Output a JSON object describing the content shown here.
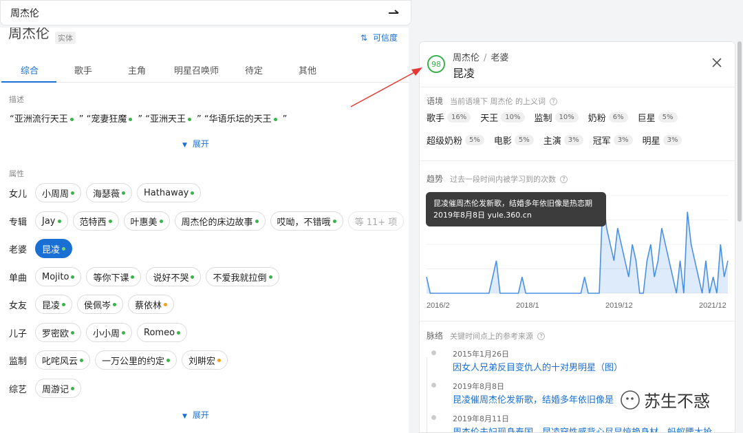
{
  "search": {
    "value": "周杰伦"
  },
  "entity": {
    "name": "周杰伦",
    "type": "实体",
    "confidence_label": "可信度"
  },
  "tabs": [
    "综合",
    "歌手",
    "主角",
    "明星召唤师",
    "待定",
    "其他"
  ],
  "description": {
    "label": "描述",
    "items": [
      "“亚洲流行天王",
      "” “宠妻狂魔",
      "” “亚洲天王",
      "” “华语乐坛的天王",
      "”"
    ],
    "expand": "展开"
  },
  "attributes": {
    "label": "属性",
    "rows": [
      {
        "key": "女儿",
        "values": [
          {
            "v": "小周周",
            "dot": "green"
          },
          {
            "v": "海瑟薇",
            "dot": "green"
          },
          {
            "v": "Hathaway",
            "dot": "green"
          }
        ]
      },
      {
        "key": "专辑",
        "values": [
          {
            "v": "Jay",
            "dot": "green"
          },
          {
            "v": "范特西",
            "dot": "green"
          },
          {
            "v": "叶惠美",
            "dot": "green"
          },
          {
            "v": "周杰伦的床边故事",
            "dot": "green"
          },
          {
            "v": "哎呦，不错哦",
            "dot": "green"
          }
        ],
        "more": "等 11+ 项"
      },
      {
        "key": "老婆",
        "values": [
          {
            "v": "昆凌",
            "dot": "green",
            "selected": true
          }
        ]
      },
      {
        "key": "单曲",
        "values": [
          {
            "v": "Mojito",
            "dot": "green"
          },
          {
            "v": "等你下课",
            "dot": "green"
          },
          {
            "v": "说好不哭",
            "dot": "green"
          },
          {
            "v": "不爱我就拉倒",
            "dot": "green"
          }
        ]
      },
      {
        "key": "女友",
        "values": [
          {
            "v": "昆凌",
            "dot": "green"
          },
          {
            "v": "侯佩岑",
            "dot": "green"
          },
          {
            "v": "蔡依林",
            "dot": "orange"
          }
        ]
      },
      {
        "key": "儿子",
        "values": [
          {
            "v": "罗密欧",
            "dot": "green"
          },
          {
            "v": "小小周",
            "dot": "green"
          },
          {
            "v": "Romeo",
            "dot": "green"
          }
        ]
      },
      {
        "key": "监制",
        "values": [
          {
            "v": "叱咤风云",
            "dot": "green"
          },
          {
            "v": "一万公里的约定",
            "dot": "green"
          },
          {
            "v": "刘畊宏",
            "dot": "orange"
          }
        ]
      },
      {
        "key": "综艺",
        "values": [
          {
            "v": "周游记",
            "dot": "green"
          }
        ]
      }
    ],
    "expand": "展开"
  },
  "detail": {
    "score": "98",
    "breadcrumb": [
      "周杰伦",
      "老婆"
    ],
    "target": "昆凌",
    "context": {
      "label": "语境",
      "sub": "当前语境下 周杰伦 的上义词",
      "rows": [
        [
          {
            "w": "歌手",
            "p": "16%"
          },
          {
            "w": "天王",
            "p": "10%"
          },
          {
            "w": "监制",
            "p": "10%"
          },
          {
            "w": "奶粉",
            "p": "6%"
          },
          {
            "w": "巨星",
            "p": "5%"
          }
        ],
        [
          {
            "w": "超级奶粉",
            "p": "5%"
          },
          {
            "w": "电影",
            "p": "5%"
          },
          {
            "w": "主演",
            "p": "3%"
          },
          {
            "w": "冠军",
            "p": "3%"
          },
          {
            "w": "明星",
            "p": "3%"
          }
        ]
      ]
    },
    "trend": {
      "label": "趋势",
      "sub": "过去一段时间内被学习到的次数",
      "tooltip_title": "昆凌催周杰伦发新歌，结婚多年依旧像是热恋期",
      "tooltip_meta": "2019年8月8日  yule.360.cn"
    },
    "timeline": {
      "label": "脉络",
      "sub": "关键时间点上的参考来源",
      "items": [
        {
          "date": "2015年1月26日",
          "title": "因女人兄弟反目变仇人的十对男明星（图）"
        },
        {
          "date": "2019年8月8日",
          "title": "昆凌催周杰伦发新歌，结婚多年依旧像是"
        },
        {
          "date": "2019年8月11日",
          "title": "周杰伦夫妇现身泰国，昆凌穿性感背心尽显惊艳身材，蚂蚁腰太抢…"
        }
      ]
    }
  },
  "chart_data": {
    "type": "area",
    "x_tick_labels": [
      "2016/2",
      "2018/1",
      "2019/12",
      "2021/12"
    ],
    "values": [
      1,
      0,
      0,
      0,
      0,
      0,
      0,
      0,
      0,
      0,
      0,
      0,
      0,
      0,
      0,
      0,
      0,
      0,
      1,
      2,
      0,
      0,
      0,
      0,
      0,
      0,
      1,
      0,
      0,
      0,
      0,
      0,
      0,
      0,
      0,
      0,
      0,
      0,
      0,
      0,
      0,
      0,
      0,
      1,
      0,
      0,
      0,
      0,
      6,
      4,
      3,
      2,
      4,
      3,
      2,
      1,
      3,
      2,
      0,
      0,
      2,
      3,
      1,
      2,
      4,
      3,
      2,
      1,
      0,
      2,
      0,
      5,
      3,
      2,
      1,
      0,
      2,
      0,
      1,
      0,
      3,
      1,
      2
    ],
    "highlight": {
      "date": "2019年8月8日"
    },
    "grid": true
  },
  "watermark": "苏生不惑",
  "colors": {
    "accent": "#1a6fd4",
    "green": "#3ab34a",
    "orange": "#f0a020",
    "annotation": "#e53935"
  }
}
